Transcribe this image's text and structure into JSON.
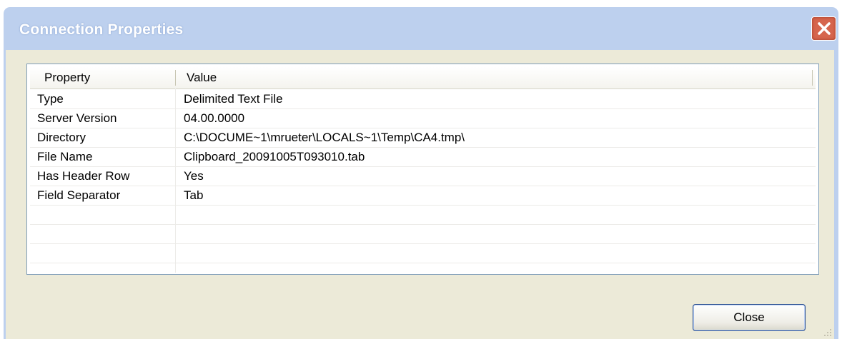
{
  "window": {
    "title": "Connection Properties",
    "close_icon": "close-icon"
  },
  "list": {
    "columns": [
      "Property",
      "Value"
    ],
    "rows": [
      {
        "property": "Type",
        "value": "Delimited Text File"
      },
      {
        "property": "Server Version",
        "value": "04.00.0000"
      },
      {
        "property": "Directory",
        "value": "C:\\DOCUME~1\\mrueter\\LOCALS~1\\Temp\\CA4.tmp\\"
      },
      {
        "property": "File Name",
        "value": "Clipboard_20091005T093010.tab"
      },
      {
        "property": "Has Header Row",
        "value": "Yes"
      },
      {
        "property": "Field Separator",
        "value": "Tab"
      }
    ]
  },
  "buttons": {
    "close_label": "Close"
  },
  "colors": {
    "titlebar": "#bdd0ee",
    "client": "#ecead8",
    "close_button": "#d6654d"
  }
}
